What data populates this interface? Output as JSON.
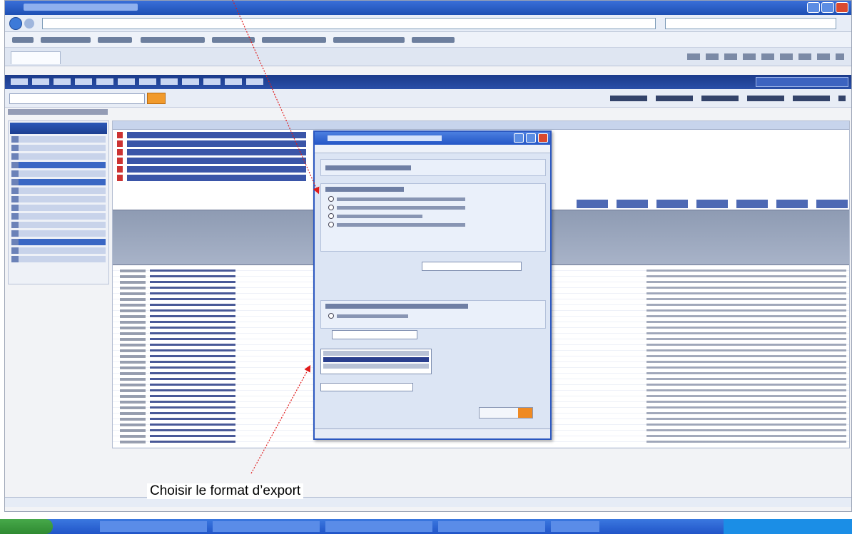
{
  "annotation": {
    "caption": "Choisir le format d’export",
    "arrow_color": "#e01b1b"
  },
  "colors": {
    "app_header": "#1b3a8a",
    "dialog_border": "#2c58c0",
    "export_button_accent": "#f08a22",
    "taskbar": "#2155c8"
  }
}
